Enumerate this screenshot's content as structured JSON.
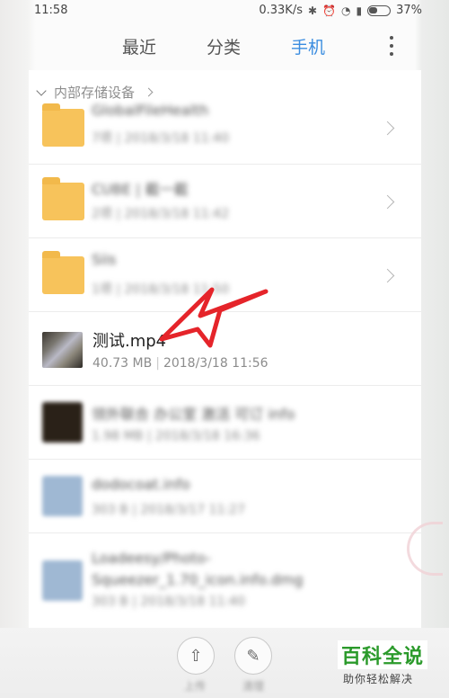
{
  "status_bar": {
    "time": "11:58",
    "speed": "0.33K/s",
    "battery": "37%"
  },
  "tabs": {
    "recent": "最近",
    "category": "分类",
    "phone": "手机"
  },
  "breadcrumb": {
    "label": "内部存储设备"
  },
  "folders": [
    {
      "name": "GlobalFileHealth",
      "meta": "7项 | 2018/3/18 11:40"
    },
    {
      "name": "CUBE | 截一截",
      "meta": "2项 | 2018/3/18 11:42"
    },
    {
      "name": "Siis",
      "meta": "1项 | 2018/3/18 11:50"
    }
  ],
  "highlight_file": {
    "name": "测试.mp4",
    "size": "40.73 MB",
    "date": "2018/3/18 11:56"
  },
  "blurred_files": [
    {
      "name": "领外联合 办公室 激活 可订 info",
      "meta": "1.98 MB | 2018/3/18 16:36"
    },
    {
      "name": "dodocoat.info",
      "meta": "303 B | 2018/3/17 11:27"
    },
    {
      "name": "Loadeesy/Photo-Squeezer_1.70_icon.info.dmg",
      "meta": "303 B | 2018/3/18 11:40"
    }
  ],
  "bottom_actions": [
    {
      "label": "上传"
    },
    {
      "label": "清理"
    }
  ],
  "watermark": {
    "title": "百科全说",
    "subtitle": "助你轻松解决"
  },
  "colors": {
    "accent": "#3b8de0",
    "folder": "#f7c35b",
    "arrow": "#e5242a",
    "watermark_green": "#2b9a2b"
  }
}
